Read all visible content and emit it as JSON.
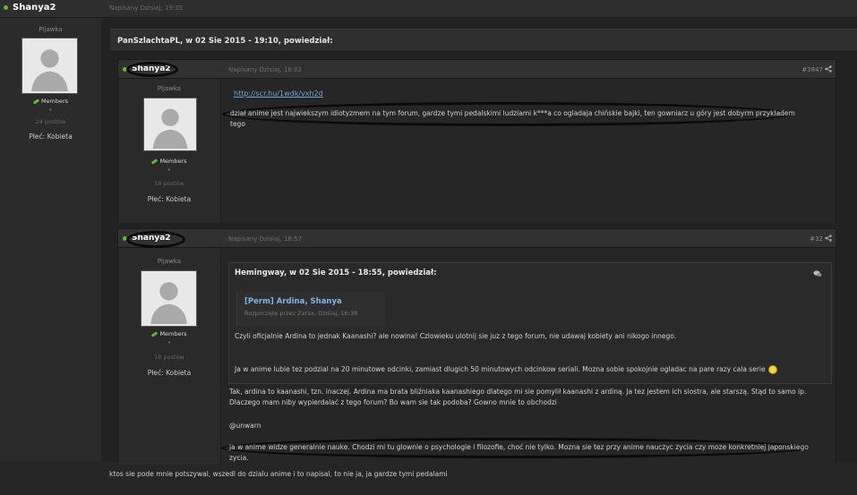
{
  "top": {
    "username": "Shanya2",
    "posted": "Napisany Dzisiaj, 19:35"
  },
  "left_profile": {
    "rank": "Pijawka",
    "group": "Members",
    "bullet": "•",
    "posts": "24 postów",
    "gender": "Płeć: Kobieta"
  },
  "outer_quote_header": "PanSzlachtaPL, w 02 Sie 2015 - 19:10, powiedział:",
  "post1": {
    "username": "Shanya2",
    "posted": "Napisany Dzisiaj, 18:02",
    "number": "#3847",
    "profile": {
      "rank": "Pijawka",
      "group": "Members",
      "bullet": "•",
      "posts": "18 postów",
      "gender": "Płeć: Kobieta"
    },
    "link": "http://scr.hu/1wdk/vxh2d",
    "text": "dział anime jest najwiekszym idiotyzmem na tym forum, gardze tymi pedalskimi ludziami k***a co ogladaja chińskie bajki, ten gowniarz u góry jest dobyrm przykladem tego"
  },
  "post2": {
    "username": "Shanya2",
    "posted": "Napisany Dzisiaj, 18:57",
    "number": "#32",
    "profile": {
      "rank": "Pijawka",
      "group": "Members",
      "bullet": "•",
      "posts": "18 postów",
      "gender": "Płeć: Kobieta"
    },
    "quote": {
      "header": "Hemingway, w 02 Sie 2015 - 18:55, powiedział:",
      "embed_title": "[Perm] Ardina, Shanya",
      "embed_sub": "Rozpoczęte przez Zarax, Dzisiaj, 16:38",
      "line1": "Czyli oficjalnie Ardina to jednak Kaanashi? ale nowina! Czlowieku ulotnij sie juz z tego forum, nie udawaj kobiety ani nikogo innego.",
      "line2": "Ja w anime lubie tez podzial na 20 minutowe odcinki, zamiast dlugich 50 minutowych odcinkow seriali. Mozna sobie spokojnie ogladac na pare razy cala serie"
    },
    "text1": "Tak, ardina to kaanashi, tzn. inaczej. Ardina ma brata bliźniaka kaanashiego dlatego mi sie pomylił kaanashi z ardiną. Ja tez jestem ich siostra, ale starszą. Stąd to samo ip. Dlaczego mam niby wypierdalać z tego forum? Bo wam sie tak podoba? Gowno mnie to obchodzi",
    "mention": "@unwarn",
    "text2": "ja w anime widze generalnie nauke. Chodzi mi tu glownie o psychologie i filozofie, choć nie tylko. Mozna sie tez przy anime nauczyc zycia czy moze konkretniej japonskiego zycia."
  },
  "footer_text": "ktos sie pode mnie potszywal, wszedl do dzialu anime i to napisal, to nie ja, ja gardze tymi pedalami",
  "colors": {
    "online": "#5dbb33",
    "link": "#6fa6df",
    "background": "#222222"
  },
  "icons": [
    "online-dot-icon",
    "share-icon",
    "quote-bubble-icon",
    "members-leaf-icon",
    "smiley-icon",
    "avatar-placeholder-icon"
  ]
}
